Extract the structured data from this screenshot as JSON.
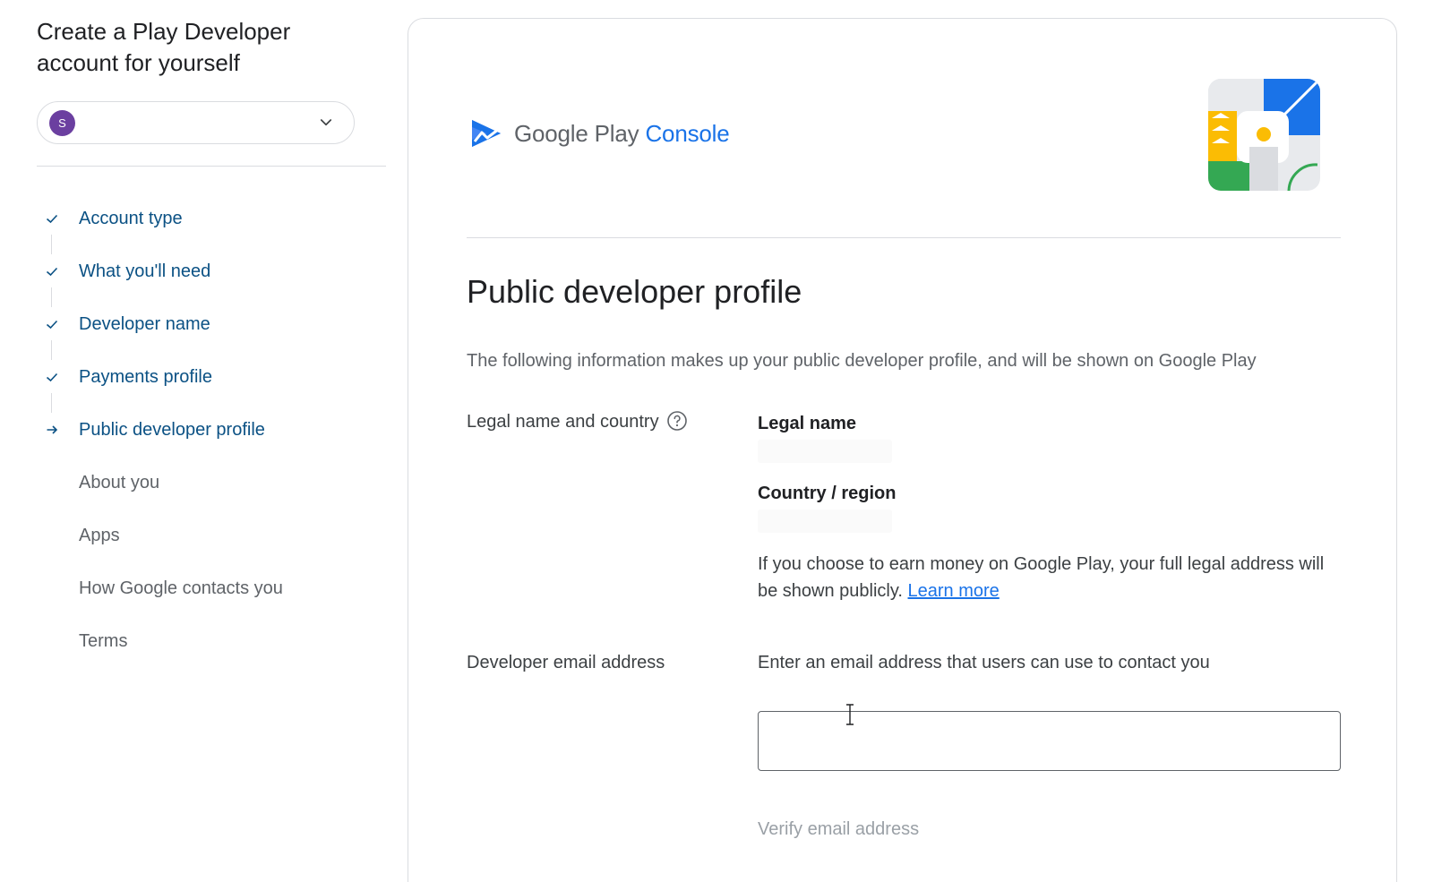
{
  "sidebar": {
    "title": "Create a Play Developer account for yourself",
    "account": {
      "avatar_letter": "S",
      "avatar_color": "#6b3fa0"
    },
    "steps": [
      {
        "label": "Account type",
        "status": "done"
      },
      {
        "label": "What you'll need",
        "status": "done"
      },
      {
        "label": "Developer name",
        "status": "done"
      },
      {
        "label": "Payments profile",
        "status": "done"
      },
      {
        "label": "Public developer profile",
        "status": "current"
      },
      {
        "label": "About you",
        "status": "todo"
      },
      {
        "label": "Apps",
        "status": "todo"
      },
      {
        "label": "How Google contacts you",
        "status": "todo"
      },
      {
        "label": "Terms",
        "status": "todo"
      }
    ]
  },
  "brand": {
    "name_google": "Google Play",
    "name_console": "Console"
  },
  "main": {
    "title": "Public developer profile",
    "description": "The following information makes up your public developer profile, and will be shown on Google Play",
    "legal": {
      "row_label": "Legal name and country",
      "legal_name_label": "Legal name",
      "country_label": "Country / region",
      "notice_text": "If you choose to earn money on Google Play, your full legal address will be shown publicly.",
      "learn_more": "Learn more"
    },
    "email": {
      "row_label": "Developer email address",
      "hint": "Enter an email address that users can use to contact you",
      "value": "",
      "placeholder": "",
      "verify_label": "Verify email address"
    }
  },
  "colors": {
    "accent": "#1a73e8",
    "step_active": "#0b5184",
    "step_todo": "#5f6368"
  }
}
